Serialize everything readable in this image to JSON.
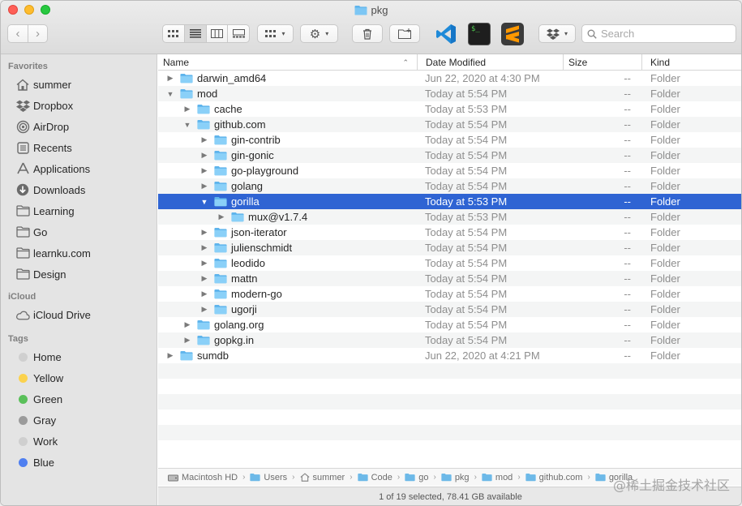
{
  "window": {
    "title": "pkg"
  },
  "search": {
    "placeholder": "Search"
  },
  "sidebar": {
    "favorites_label": "Favorites",
    "favorites": [
      {
        "label": "summer",
        "icon": "home-icon"
      },
      {
        "label": "Dropbox",
        "icon": "dropbox-icon"
      },
      {
        "label": "AirDrop",
        "icon": "airdrop-icon"
      },
      {
        "label": "Recents",
        "icon": "recents-icon"
      },
      {
        "label": "Applications",
        "icon": "applications-icon"
      },
      {
        "label": "Downloads",
        "icon": "downloads-icon"
      },
      {
        "label": "Learning",
        "icon": "folder-icon"
      },
      {
        "label": "Go",
        "icon": "folder-icon"
      },
      {
        "label": "learnku.com",
        "icon": "folder-icon"
      },
      {
        "label": "Design",
        "icon": "folder-icon"
      }
    ],
    "icloud_label": "iCloud",
    "icloud": [
      {
        "label": "iCloud Drive",
        "icon": "cloud-icon"
      }
    ],
    "tags_label": "Tags",
    "tags": [
      {
        "label": "Home",
        "color": "#cfcfcf"
      },
      {
        "label": "Yellow",
        "color": "#fbd24e"
      },
      {
        "label": "Green",
        "color": "#5ac05a"
      },
      {
        "label": "Gray",
        "color": "#9b9b9b"
      },
      {
        "label": "Work",
        "color": "#cfcfcf"
      },
      {
        "label": "Blue",
        "color": "#4f7ff0"
      }
    ]
  },
  "columns": {
    "name": "Name",
    "date": "Date Modified",
    "size": "Size",
    "kind": "Kind"
  },
  "rows": [
    {
      "name": "darwin_amd64",
      "depth": 0,
      "expanded": false,
      "date": "Jun 22, 2020 at 4:30 PM",
      "size": "--",
      "kind": "Folder"
    },
    {
      "name": "mod",
      "depth": 0,
      "expanded": true,
      "date": "Today at 5:54 PM",
      "size": "--",
      "kind": "Folder"
    },
    {
      "name": "cache",
      "depth": 1,
      "expanded": false,
      "date": "Today at 5:53 PM",
      "size": "--",
      "kind": "Folder"
    },
    {
      "name": "github.com",
      "depth": 1,
      "expanded": true,
      "date": "Today at 5:54 PM",
      "size": "--",
      "kind": "Folder"
    },
    {
      "name": "gin-contrib",
      "depth": 2,
      "expanded": false,
      "date": "Today at 5:54 PM",
      "size": "--",
      "kind": "Folder"
    },
    {
      "name": "gin-gonic",
      "depth": 2,
      "expanded": false,
      "date": "Today at 5:54 PM",
      "size": "--",
      "kind": "Folder"
    },
    {
      "name": "go-playground",
      "depth": 2,
      "expanded": false,
      "date": "Today at 5:54 PM",
      "size": "--",
      "kind": "Folder"
    },
    {
      "name": "golang",
      "depth": 2,
      "expanded": false,
      "date": "Today at 5:54 PM",
      "size": "--",
      "kind": "Folder"
    },
    {
      "name": "gorilla",
      "depth": 2,
      "expanded": true,
      "selected": true,
      "date": "Today at 5:53 PM",
      "size": "--",
      "kind": "Folder"
    },
    {
      "name": "mux@v1.7.4",
      "depth": 3,
      "expanded": false,
      "date": "Today at 5:53 PM",
      "size": "--",
      "kind": "Folder"
    },
    {
      "name": "json-iterator",
      "depth": 2,
      "expanded": false,
      "date": "Today at 5:54 PM",
      "size": "--",
      "kind": "Folder"
    },
    {
      "name": "julienschmidt",
      "depth": 2,
      "expanded": false,
      "date": "Today at 5:54 PM",
      "size": "--",
      "kind": "Folder"
    },
    {
      "name": "leodido",
      "depth": 2,
      "expanded": false,
      "date": "Today at 5:54 PM",
      "size": "--",
      "kind": "Folder"
    },
    {
      "name": "mattn",
      "depth": 2,
      "expanded": false,
      "date": "Today at 5:54 PM",
      "size": "--",
      "kind": "Folder"
    },
    {
      "name": "modern-go",
      "depth": 2,
      "expanded": false,
      "date": "Today at 5:54 PM",
      "size": "--",
      "kind": "Folder"
    },
    {
      "name": "ugorji",
      "depth": 2,
      "expanded": false,
      "date": "Today at 5:54 PM",
      "size": "--",
      "kind": "Folder"
    },
    {
      "name": "golang.org",
      "depth": 1,
      "expanded": false,
      "date": "Today at 5:54 PM",
      "size": "--",
      "kind": "Folder"
    },
    {
      "name": "gopkg.in",
      "depth": 1,
      "expanded": false,
      "date": "Today at 5:54 PM",
      "size": "--",
      "kind": "Folder"
    },
    {
      "name": "sumdb",
      "depth": 0,
      "expanded": false,
      "date": "Jun 22, 2020 at 4:21 PM",
      "size": "--",
      "kind": "Folder"
    }
  ],
  "pathbar": [
    {
      "label": "Macintosh HD",
      "icon": "disk-icon"
    },
    {
      "label": "Users",
      "icon": "folder-icon"
    },
    {
      "label": "summer",
      "icon": "home-icon"
    },
    {
      "label": "Code",
      "icon": "folder-icon"
    },
    {
      "label": "go",
      "icon": "folder-icon"
    },
    {
      "label": "pkg",
      "icon": "folder-icon"
    },
    {
      "label": "mod",
      "icon": "folder-icon"
    },
    {
      "label": "github.com",
      "icon": "folder-icon"
    },
    {
      "label": "gorilla",
      "icon": "folder-icon"
    }
  ],
  "status": {
    "text": "1 of 19 selected, 78.41 GB available"
  },
  "watermark": "@稀土掘金技术社区",
  "colors": {
    "selection": "#2f64d3",
    "folder": "#5eb4ec"
  }
}
